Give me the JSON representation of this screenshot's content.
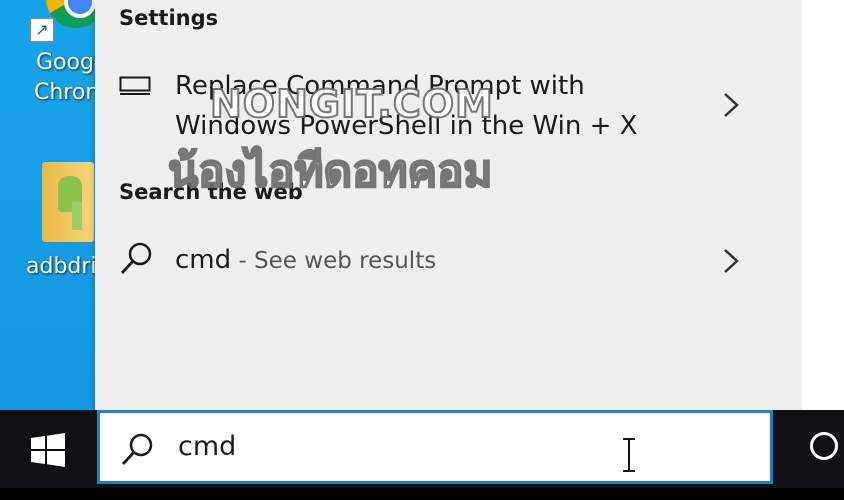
{
  "desktop": {
    "icons": [
      {
        "label": "Goog\nChron",
        "line1": "Goog",
        "line2": "Chron",
        "icon": "chrome-icon"
      },
      {
        "label": "adbdri",
        "icon": "folder-icon"
      }
    ]
  },
  "panel": {
    "settings_header": "Settings",
    "settings_result": {
      "line1": "Replace Command Prompt with",
      "line2": "Windows PowerShell in the Win + X",
      "icon": "monitor-icon"
    },
    "web_header": "Search the web",
    "web_result": {
      "query": "cmd",
      "suffix": " - See web results",
      "icon": "search-icon"
    }
  },
  "watermark": {
    "line1": "NONGIT.COM",
    "line2": "น้องไอทีดอทคอม"
  },
  "taskbar": {
    "search_value": "cmd",
    "start_icon": "windows-logo-icon",
    "cortana_icon": "cortana-icon"
  },
  "colors": {
    "accent": "#1a7fd4",
    "taskbar": "#101014",
    "panel": "#efefef",
    "desktop": "#16a3ea"
  }
}
